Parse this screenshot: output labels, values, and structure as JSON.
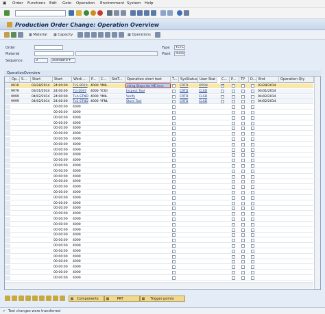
{
  "menu": [
    "Order",
    "Functions",
    "Edit",
    "Goto",
    "Operation",
    "Environment",
    "System",
    "Help"
  ],
  "title": "Production Order Change: Operation Overview",
  "app_toolbar": {
    "material": "Material",
    "capacity": "Capacity",
    "operations": "Operations"
  },
  "header": {
    "order_label": "Order",
    "material_label": "Material",
    "sequence_label": "Sequence",
    "sequence_value": "0",
    "sequence_type": "Standard",
    "type_label": "Type",
    "type_value": "YCTC",
    "plant_label": "Plant",
    "plant_value": "4000"
  },
  "grid": {
    "title": "OperationOverview",
    "columns": [
      "Op...",
      "S...",
      "Start",
      "Start",
      "Work ...",
      "P...",
      "C...",
      "StdT...",
      "Operation short text",
      "T...",
      "SysStatus",
      "User Stat",
      "C...",
      "P...",
      "TP",
      "D...",
      "End",
      "Operation Qty"
    ],
    "rows": [
      {
        "op": "0010",
        "start_date": "03/28/2014",
        "start_time": "24:00:00",
        "work": "TLS-8010",
        "plant": "4000",
        "ctrl": "YMIL",
        "text": "cking Steps for ME Inst.",
        "sys": "CRTD",
        "user": "OPEN",
        "c_on": true,
        "end": "03/28/2014",
        "highlight": true
      },
      {
        "op": "9979",
        "start_date": "03/31/2014",
        "start_time": "24:00:00",
        "work": "TLI-2097",
        "plant": "4000",
        "ctrl": "YCQI",
        "text": "Inspect Tool",
        "sys": "CRTD",
        "user": "CLSD",
        "c_on": false,
        "end": "03/31/2014",
        "highlight": false
      },
      {
        "op": "9999",
        "start_date": "04/02/2014",
        "start_time": "24:00:00",
        "work": "TLA-STND",
        "plant": "4000",
        "ctrl": "YMIL",
        "text": "Verify",
        "sys": "CRTD",
        "user": "CLSD",
        "c_on": false,
        "end": "04/02/2014",
        "highlight": false
      },
      {
        "op": "9999",
        "start_date": "04/02/2014",
        "start_time": "24:00:00",
        "work": "TLS-STND",
        "plant": "4000",
        "ctrl": "YFNL",
        "text": "Store Tool",
        "sys": "CRTD",
        "user": "CLSD",
        "c_on": false,
        "end": "04/02/2014",
        "highlight": false
      }
    ],
    "empty_time": "00:00:00",
    "empty_plant": "4000"
  },
  "bottom": {
    "components": "Components",
    "prt": "PRT",
    "trigger": "Trigger points"
  },
  "status_text": "Text changes were transferred"
}
